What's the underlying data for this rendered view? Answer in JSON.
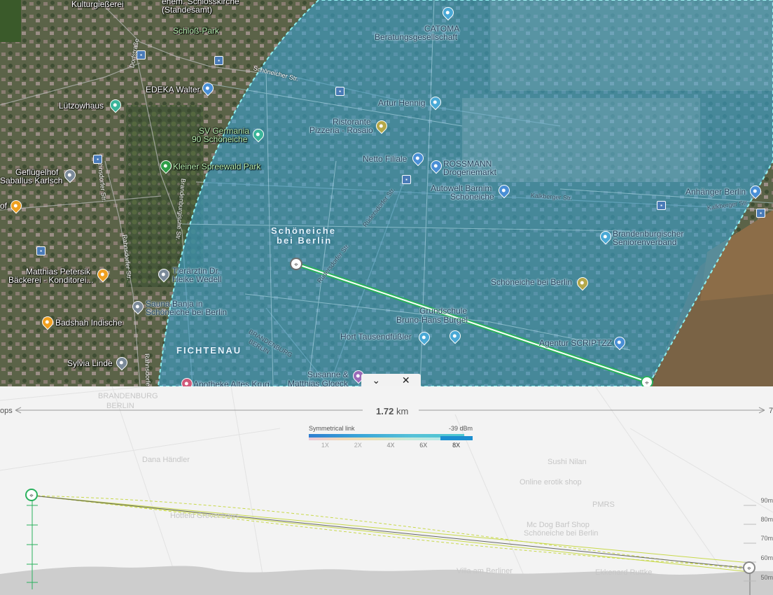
{
  "map": {
    "labels": [
      {
        "text": "Kulturgießerei"
      },
      {
        "text": "ehem. Schlosskirche"
      },
      {
        "text": "(Standesamt)"
      },
      {
        "text": "Schloß-Park"
      },
      {
        "text": "CATOMA"
      },
      {
        "text": "Beratungsgesellschaft"
      },
      {
        "text": "EDEKA Walter"
      },
      {
        "text": "Lützowhaus"
      },
      {
        "text": "Artur Hennig"
      },
      {
        "text": "Ristorante"
      },
      {
        "text": "Pizzeria - Rosaio"
      },
      {
        "text": "SV Germania"
      },
      {
        "text": "90 Schöneiche"
      },
      {
        "text": "Netto Filiale"
      },
      {
        "text": "ROSSMANN"
      },
      {
        "text": "Drogeriemarkt"
      },
      {
        "text": "Kleiner Spreewald Park"
      },
      {
        "text": "Geflügelhof"
      },
      {
        "text": "Saballus Karlsch"
      },
      {
        "text": "Autowelt Barnim"
      },
      {
        "text": "Schöneiche"
      },
      {
        "text": "Anhänger Berlin"
      },
      {
        "text": "Schöneiche"
      },
      {
        "text": "bei Berlin"
      },
      {
        "text": "Brandenburgischer"
      },
      {
        "text": "Seniorenverband"
      },
      {
        "text": "Matthias Petersik"
      },
      {
        "text": "Bäckerei - Konditorei..."
      },
      {
        "text": "Tierärztin Dr."
      },
      {
        "text": "Heike Wedell"
      },
      {
        "text": "Schöneiche bei Berlin"
      },
      {
        "text": "Sauna Banja in"
      },
      {
        "text": "Schöneiche bei Berlin"
      },
      {
        "text": "Grundschule"
      },
      {
        "text": "Bruno-Hans Bürgel"
      },
      {
        "text": "Badshah Indische"
      },
      {
        "text": "Hort Tausendfüßler"
      },
      {
        "text": "Agentur SCRIPTZZ"
      },
      {
        "text": "FICHTENAU"
      },
      {
        "text": "Sylvia Linde"
      },
      {
        "text": "Susanne &"
      },
      {
        "text": "Apotheke Altes Krug"
      },
      {
        "text": "Matthias Gloeck"
      },
      {
        "text": "of"
      }
    ],
    "streets": [
      {
        "text": "Schöneicher Str."
      },
      {
        "text": "Dorfstraße"
      },
      {
        "text": "Rahnsdorfer Str."
      },
      {
        "text": "Brandenburgische Str."
      },
      {
        "text": "Rüdersdorfer Str."
      },
      {
        "text": "Kalkberger Str."
      },
      {
        "text": "Kalkberger Str."
      },
      {
        "text": "Rüdersdorfer Str."
      },
      {
        "text": "Rahnsdorfer Str."
      },
      {
        "text": "BRANDENBURG"
      },
      {
        "text": "BERLIN"
      },
      {
        "text": "Rahnsdorfer Str."
      }
    ],
    "coverage_color": "#3aa0cc",
    "link_color": "#3dbb6a"
  },
  "controls": {
    "collapse_icon": "chevron-down-icon",
    "close_icon": "close-icon",
    "collapse_glyph": "⌄",
    "close_glyph": "✕"
  },
  "profile": {
    "left_partial_label": "ops",
    "right_partial_label": "7",
    "distance_value": "1.72",
    "distance_unit": "km",
    "legend": {
      "link_type": "Symmetrical link",
      "signal_value": "-39",
      "signal_unit": "dBm",
      "ticks": [
        "1X",
        "2X",
        "4X",
        "6X",
        "8X"
      ],
      "active_tick": "8X"
    },
    "height_labels": [
      "90m",
      "80m",
      "70m",
      "60m",
      "50m"
    ],
    "ghost_labels": [
      {
        "text": "Dana Händler"
      },
      {
        "text": "Sushi Nilan"
      },
      {
        "text": "Online erotik shop"
      },
      {
        "text": "PMRS"
      },
      {
        "text": "Mc Dog Barf Shop"
      },
      {
        "text": "Schöneiche bei Berlin"
      },
      {
        "text": "Villa am Berliner"
      },
      {
        "text": "Ekkenard Ruttke"
      },
      {
        "text": "BRANDENBURG"
      },
      {
        "text": "BERLIN"
      },
      {
        "text": "Hotfeld Grevenhaus"
      }
    ]
  }
}
